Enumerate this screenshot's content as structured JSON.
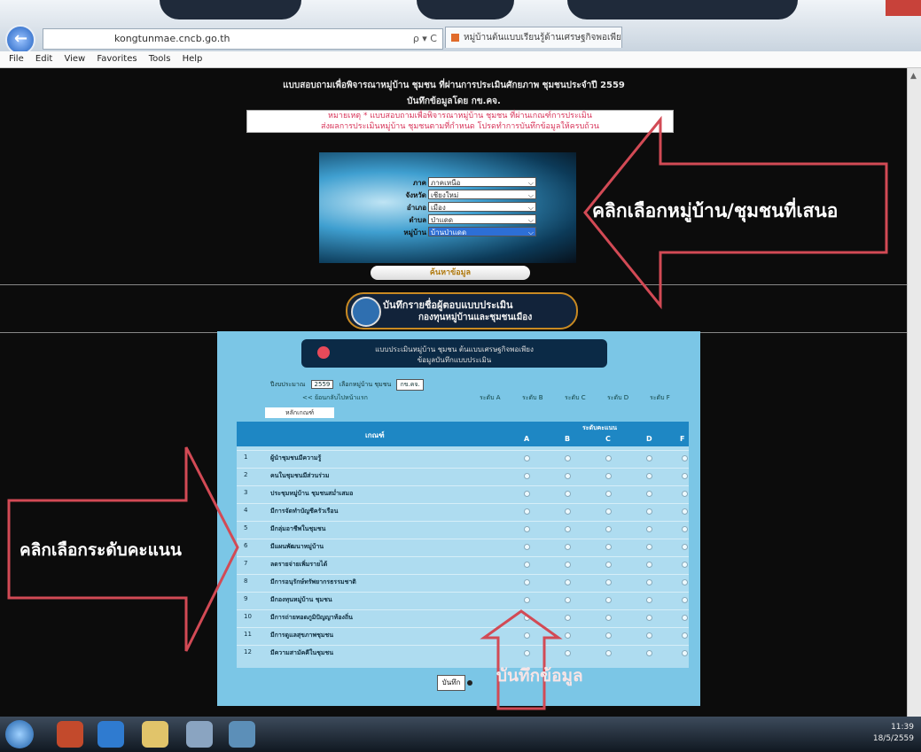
{
  "browser": {
    "address_url": "kongtunmae.cncb.go.th",
    "address_controls": "ρ ▾ C",
    "tab_title": "หมู่บ้านต้นแบบเรียนรู้ด้านเศรษฐกิจพอเพียง",
    "menu": [
      "File",
      "Edit",
      "View",
      "Favorites",
      "Tools",
      "Help"
    ]
  },
  "page": {
    "title": "แบบสอบถามเพื่อพิจารณาหมู่บ้าน ชุมชน ที่ผ่านการประเมินศักยภาพ ชุมชนประจำปี 2559",
    "subtitle": "บันทึกข้อมูลโดย กข.คจ.",
    "notice_line1": "หมายเหตุ * แบบสอบถามเพื่อพิจารณาหมู่บ้าน ชุมชน ที่ผ่านเกณฑ์การประเมิน",
    "notice_line2": "ส่งผลการประเมินหมู่บ้าน ชุมชนตามที่กำหนด โปรดทำการบันทึกข้อมูลให้ครบถ้วน",
    "selectors": [
      {
        "label": "ภาค",
        "value": "ภาคเหนือ"
      },
      {
        "label": "จังหวัด",
        "value": "เชียงใหม่"
      },
      {
        "label": "อำเภอ",
        "value": "เมือง"
      },
      {
        "label": "ตำบล",
        "value": "ป่าแดด"
      },
      {
        "label": "หมู่บ้าน",
        "value": "บ้านป่าแดด"
      }
    ],
    "submit_label": "ค้นหาข้อมูล",
    "save_banner_line1": "บันทึกรายชื่อผู้ตอบแบบประเมิน",
    "save_banner_line2": "กองทุนหมู่บ้านและชุมชนเมือง"
  },
  "form": {
    "heading_line1": "แบบประเมินหมู่บ้าน ชุมชน ต้นแบบเศรษฐกิจพอเพียง",
    "heading_line2": "ข้อมูลบันทึกแบบประเมิน",
    "filter_label": "ปีงบประมาณ",
    "filter_year": "2559",
    "filter_label2": "เลือกหมู่บ้าน ชุมชน",
    "filter_village": "กข.คจ.",
    "back_link": "<< ย้อนกลับไปหน้าแรก",
    "level_links": [
      "ระดับ A",
      "ระดับ B",
      "ระดับ C",
      "ระดับ D",
      "ระดับ F"
    ],
    "row_label": "หลักเกณฑ์",
    "col_criteria": "เกณฑ์",
    "col_levels_header": "ระดับคะแนน",
    "levels": [
      "A",
      "B",
      "C",
      "D",
      "F"
    ],
    "criteria": [
      {
        "no": "1",
        "text": "ผู้นำชุมชนมีความรู้"
      },
      {
        "no": "2",
        "text": "คนในชุมชนมีส่วนร่วม"
      },
      {
        "no": "3",
        "text": "ประชุมหมู่บ้าน ชุมชนสม่ำเสมอ"
      },
      {
        "no": "4",
        "text": "มีการจัดทำบัญชีครัวเรือน"
      },
      {
        "no": "5",
        "text": "มีกลุ่มอาชีพในชุมชน"
      },
      {
        "no": "6",
        "text": "มีแผนพัฒนาหมู่บ้าน"
      },
      {
        "no": "7",
        "text": "ลดรายจ่ายเพิ่มรายได้"
      },
      {
        "no": "8",
        "text": "มีการอนุรักษ์ทรัพยากรธรรมชาติ"
      },
      {
        "no": "9",
        "text": "มีกองทุนหมู่บ้าน ชุมชน"
      },
      {
        "no": "10",
        "text": "มีการถ่ายทอดภูมิปัญญาท้องถิ่น"
      },
      {
        "no": "11",
        "text": "มีการดูแลสุขภาพชุมชน"
      },
      {
        "no": "12",
        "text": "มีความสามัคคีในชุมชน"
      }
    ],
    "save_button": "บันทึก"
  },
  "annotations": {
    "select_village": "คลิกเลือกหมู่บ้าน/ชุมชนที่เสนอ",
    "select_score": "คลิกเลือกระดับคะแนน",
    "save_data": "บันทึกข้อมูล"
  },
  "taskbar": {
    "time": "11:39",
    "date": "18/5/2559"
  },
  "colors": {
    "annotation_red": "#d24a55",
    "panel_blue": "#7bc6e6",
    "table_head": "#1e87c4"
  }
}
